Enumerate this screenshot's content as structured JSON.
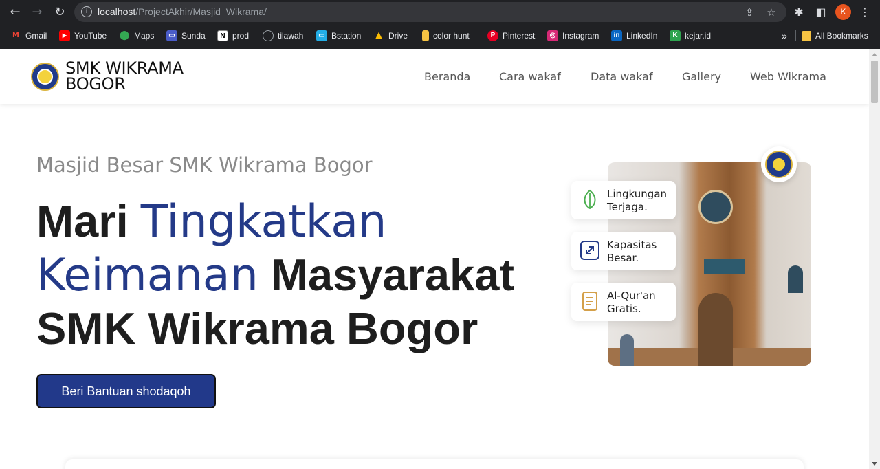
{
  "browser": {
    "url_host": "localhost",
    "url_path": "/ProjectAkhir/Masjid_Wikrama/",
    "profile_initial": "K",
    "bookmarks": [
      {
        "label": "Gmail",
        "icon": "gmail-icon",
        "color": "#ea4335"
      },
      {
        "label": "YouTube",
        "icon": "youtube-icon",
        "color": "#ff0000"
      },
      {
        "label": "Maps",
        "icon": "maps-icon",
        "color": "#34a853"
      },
      {
        "label": "Sunda",
        "icon": "sunda-icon",
        "color": "#4a5cc7"
      },
      {
        "label": "prod",
        "icon": "notion-icon",
        "color": "#e8eaed"
      },
      {
        "label": "tilawah",
        "icon": "tilawah-icon",
        "color": "#9aa0a6"
      },
      {
        "label": "Bstation",
        "icon": "bstation-icon",
        "color": "#23ade5"
      },
      {
        "label": "Drive",
        "icon": "drive-icon",
        "color": "#fbbc04"
      },
      {
        "label": "color hunt",
        "icon": "colorhunt-icon",
        "color": "#f6c343"
      },
      {
        "label": "Pinterest",
        "icon": "pinterest-icon",
        "color": "#e60023"
      },
      {
        "label": "Instagram",
        "icon": "instagram-icon",
        "color": "#d62976"
      },
      {
        "label": "LinkedIn",
        "icon": "linkedin-icon",
        "color": "#0a66c2"
      },
      {
        "label": "kejar.id",
        "icon": "kejar-icon",
        "color": "#2ea44f"
      }
    ],
    "overflow_label": "»",
    "all_bookmarks_label": "All Bookmarks"
  },
  "site": {
    "brand_line1": "SMK WIKRAMA",
    "brand_line2": "BOGOR",
    "nav": [
      "Beranda",
      "Cara wakaf",
      "Data wakaf",
      "Gallery",
      "Web Wikrama"
    ]
  },
  "hero": {
    "subtitle": "Masjid Besar SMK Wikrama Bogor",
    "headline": {
      "part1": "Mari ",
      "accent1": "Tingkatkan",
      "accent2": "Keimanan",
      "part2": " Masyarakat",
      "part3": "SMK Wikrama Bogor"
    },
    "cta_label": "Beri Bantuan shodaqoh",
    "features": [
      {
        "line1": "Lingkungan",
        "line2": "Terjaga.",
        "icon": "leaf-icon",
        "color": "#4caf50"
      },
      {
        "line1": "Kapasitas",
        "line2": "Besar.",
        "icon": "expand-icon",
        "color": "#243a88"
      },
      {
        "line1": "Al-Qur'an",
        "line2": "Gratis.",
        "icon": "book-icon",
        "color": "#d4a04a"
      }
    ]
  },
  "colors": {
    "accent": "#243a88",
    "button": "#22398a"
  }
}
